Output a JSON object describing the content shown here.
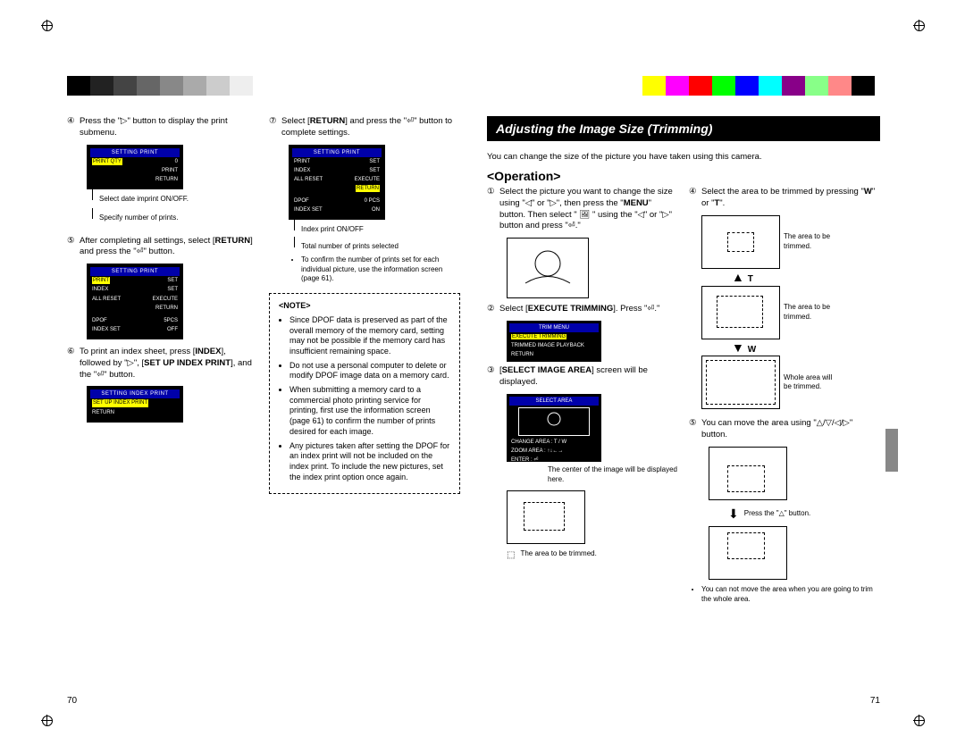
{
  "colorbar_left": [
    "#000",
    "#222",
    "#444",
    "#666",
    "#888",
    "#aaa",
    "#ccc",
    "#eee",
    "#fff"
  ],
  "colorbar_right": [
    "#ff0",
    "#f0f",
    "#f00",
    "#0f0",
    "#00f",
    "#0ff",
    "#808",
    "#8f8",
    "#f88",
    "#000",
    "#fff"
  ],
  "page70": {
    "number": "70",
    "steps": {
      "s4": {
        "n": "④",
        "text_a": "Press the \"▷\" button to display the print submenu."
      },
      "s4_callouts": {
        "a": "Select date imprint ON/OFF.",
        "b": "Specify number of prints."
      },
      "lcd4": {
        "title": "SETTING PRINT",
        "rows": [
          [
            "PRINT QTY",
            "0"
          ],
          [
            "",
            "PRINT"
          ],
          [
            "",
            "RETURN"
          ]
        ]
      },
      "s5": {
        "n": "⑤",
        "text": "After completing all settings, select [RETURN] and press the \"⏎\" button."
      },
      "lcd5": {
        "title": "SETTING PRINT",
        "rows": [
          [
            "PRINT",
            "SET"
          ],
          [
            "INDEX",
            "SET"
          ],
          [
            "ALL RESET",
            "EXECUTE"
          ],
          [
            "",
            "RETURN"
          ],
          [
            "DPOF",
            "5PCS"
          ],
          [
            "INDEX SET",
            "OFF"
          ]
        ]
      },
      "s6": {
        "n": "⑥",
        "text_a": "To print an index sheet, press [",
        "text_b": "INDEX",
        "text_c": "], followed by \"▷\", [",
        "text_d": "SET UP INDEX PRINT",
        "text_e": "], and the \"⏎\" button."
      },
      "lcd6": {
        "title": "SETTING INDEX PRINT",
        "rows": [
          [
            "SET UP INDEX PRINT",
            ""
          ],
          [
            "RETURN",
            ""
          ]
        ]
      },
      "s7": {
        "n": "⑦",
        "text_a": "Select [",
        "text_b": "RETURN",
        "text_c": "] and press the \"⏎\" button to complete settings."
      },
      "lcd7": {
        "title": "SETTING PRINT",
        "rows": [
          [
            "PRINT",
            "SET"
          ],
          [
            "INDEX",
            "SET"
          ],
          [
            "ALL RESET",
            "EXECUTE"
          ],
          [
            "",
            "RETURN"
          ],
          [
            "DPOF",
            "0 PCS"
          ],
          [
            "INDEX SET",
            "ON"
          ]
        ]
      },
      "s7_callouts": {
        "a": "Index print ON/OFF",
        "b": "Total number of prints selected",
        "c": "To confirm the number of prints set for each individual picture, use the information screen (page 61)."
      }
    },
    "note": {
      "title": "<NOTE>",
      "items": [
        "Since DPOF data is preserved as part of the overall memory of the memory card, setting may not be possible if the memory card has insufficient remaining space.",
        "Do not use a personal computer to delete or modify DPOF image data on a memory card.",
        "When submitting a memory card to a commercial photo printing service for printing, first use the information screen (page 61) to confirm the number of prints desired for each image.",
        "Any pictures taken after setting the DPOF for an index print will not be included on the index print. To include the new pictures, set the index print option once again."
      ]
    }
  },
  "page71": {
    "number": "71",
    "header": "Adjusting the Image Size (Trimming)",
    "intro": "You can change the size of the picture you have taken using this camera.",
    "op_head": "<Operation>",
    "s1": {
      "n": "①",
      "text": "Select the picture you want to change the size using \"◁\" or \"▷\", then press the \"MENU\" button. Then select \" 🖼 \" using the \"◁\" or \"▷\" button and press \"⏎.\""
    },
    "s2": {
      "n": "②",
      "text_a": "Select [",
      "text_b": "EXECUTE TRIMMING",
      "text_c": "]. Press \"⏎.\""
    },
    "menu2": {
      "title": "TRIM MENU",
      "rows": [
        "EXECUTE TRIMMING",
        "TRIMMED IMAGE PLAYBACK",
        "RETURN"
      ]
    },
    "s3": {
      "n": "③",
      "text_a": "[",
      "text_b": "SELECT IMAGE AREA",
      "text_c": "] screen will be displayed."
    },
    "menu3": {
      "title": "SELECT AREA",
      "rows": [
        "CHANGE AREA : T / W",
        "ZOOM AREA : ↑↓←→",
        "ENTER : ⏎"
      ]
    },
    "s3_callouts": {
      "a": "The center of the image will be displayed here.",
      "b": "The area to be trimmed."
    },
    "s4": {
      "n": "④",
      "text": "Select the area to be trimmed by pressing \"W\" or \"T\"."
    },
    "s4_labels": {
      "a": "The area to be trimmed.",
      "b": "The area to be trimmed.",
      "c": "Whole area will be trimmed.",
      "T": "T",
      "W": "W"
    },
    "s5": {
      "n": "⑤",
      "text": "You can move the area using \"△/▽/◁/▷\" button."
    },
    "s5_label": "Press the \"△\" button.",
    "s5_note": "You can not move the area when you are going to trim the whole area."
  }
}
